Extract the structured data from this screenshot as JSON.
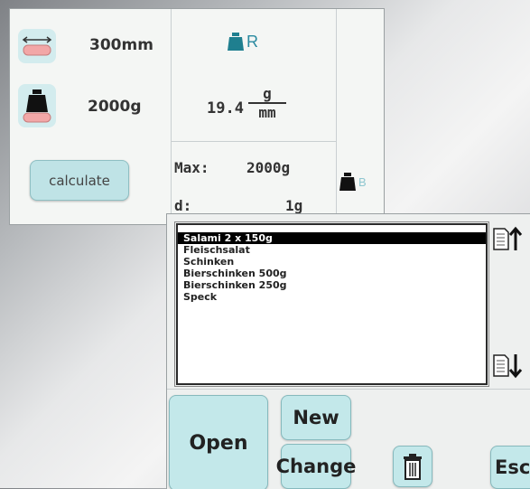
{
  "top_screen": {
    "length_value": "300mm",
    "weight_value": "2000g",
    "resolution_value": "19.4",
    "resolution_unit_num": "g",
    "resolution_unit_den": "mm",
    "calculate_label": "calculate",
    "max_label": "Max:",
    "max_value": "2000g",
    "d_label": "d:",
    "d_value": "1g",
    "icon_letter_r": "R",
    "icon_letter_b": "B"
  },
  "bottom_screen": {
    "list_items": [
      "Salami 2 x 150g",
      "Fleischsalat",
      "Schinken",
      "Bierschinken 500g",
      "Bierschinken 250g",
      "Speck"
    ],
    "selected_index": 0,
    "open_label": "Open",
    "new_label": "New",
    "change_label": "Change",
    "esc_label": "Esc"
  },
  "colors": {
    "button_fill": "#c3e8ea",
    "weight_icon": "#111111",
    "weight_base": "#f2a7a7",
    "r_weight_icon": "#1f7f8f"
  },
  "icons": [
    "length-ruler-icon",
    "weight-icon",
    "r-weight-icon",
    "b-weight-icon",
    "trash-icon",
    "scroll-up-icon",
    "scroll-down-icon"
  ]
}
